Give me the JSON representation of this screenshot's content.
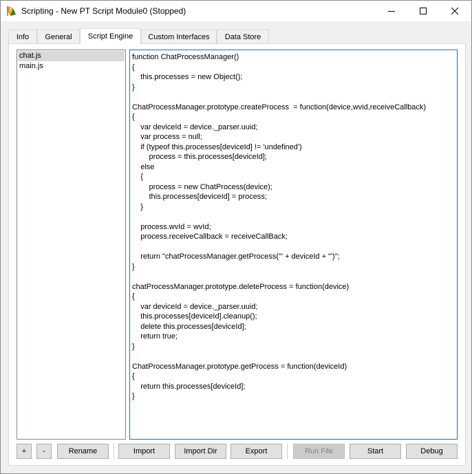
{
  "window": {
    "title": "Scripting - New PT Script Module0 (Stopped)",
    "icon": "packet-tracer-script-icon"
  },
  "tabs": [
    {
      "label": "Info"
    },
    {
      "label": "General"
    },
    {
      "label": "Script Engine",
      "active": true
    },
    {
      "label": "Custom Interfaces"
    },
    {
      "label": "Data Store"
    }
  ],
  "files": [
    {
      "name": "chat.js",
      "selected": true
    },
    {
      "name": "main.js",
      "selected": false
    }
  ],
  "code": [
    "function ChatProcessManager()",
    "{",
    "    this.processes = new Object();",
    "}",
    "",
    "ChatProcessManager.prototype.createProcess  = function(device,wvid,receiveCallback)",
    "{",
    "    var deviceId = device._parser.uuid;",
    "    var process = null;",
    "    if (typeof this.processes[deviceId] != 'undefined')",
    "        process = this.processes[deviceId];",
    "    else",
    "    {",
    "        process = new ChatProcess(device);",
    "        this.processes[deviceId] = process;",
    "    }",
    "",
    "    process.wvId = wvId;",
    "    process.receiveCallback = receiveCallBack;",
    "",
    "    return \"chatProcessManager.getProcess('\" + deviceId + \"')\";",
    "}",
    "",
    "chatProcessManager.prototype.deleteProcess = function(device)",
    "{",
    "    var deviceId = device._parser.uuid;",
    "    this.processes[deviceId].cleanup();",
    "    delete this.processes[deviceId];",
    "    return true;",
    "}",
    "",
    "ChatProcessManager.prototype.getProcess = function(deviceId)",
    "{",
    "    return this.processes[deviceId];",
    "}"
  ],
  "buttons": {
    "add": "+",
    "remove": "-",
    "rename": "Rename",
    "import": "Import",
    "import_dir": "Import Dir",
    "export": "Export",
    "run_file": "Run File",
    "start": "Start",
    "debug": "Debug"
  },
  "colors": {
    "editor_focus_border": "#0078d7",
    "selected_item": "#d9d9d9",
    "button_face": "#e1e1e1"
  }
}
